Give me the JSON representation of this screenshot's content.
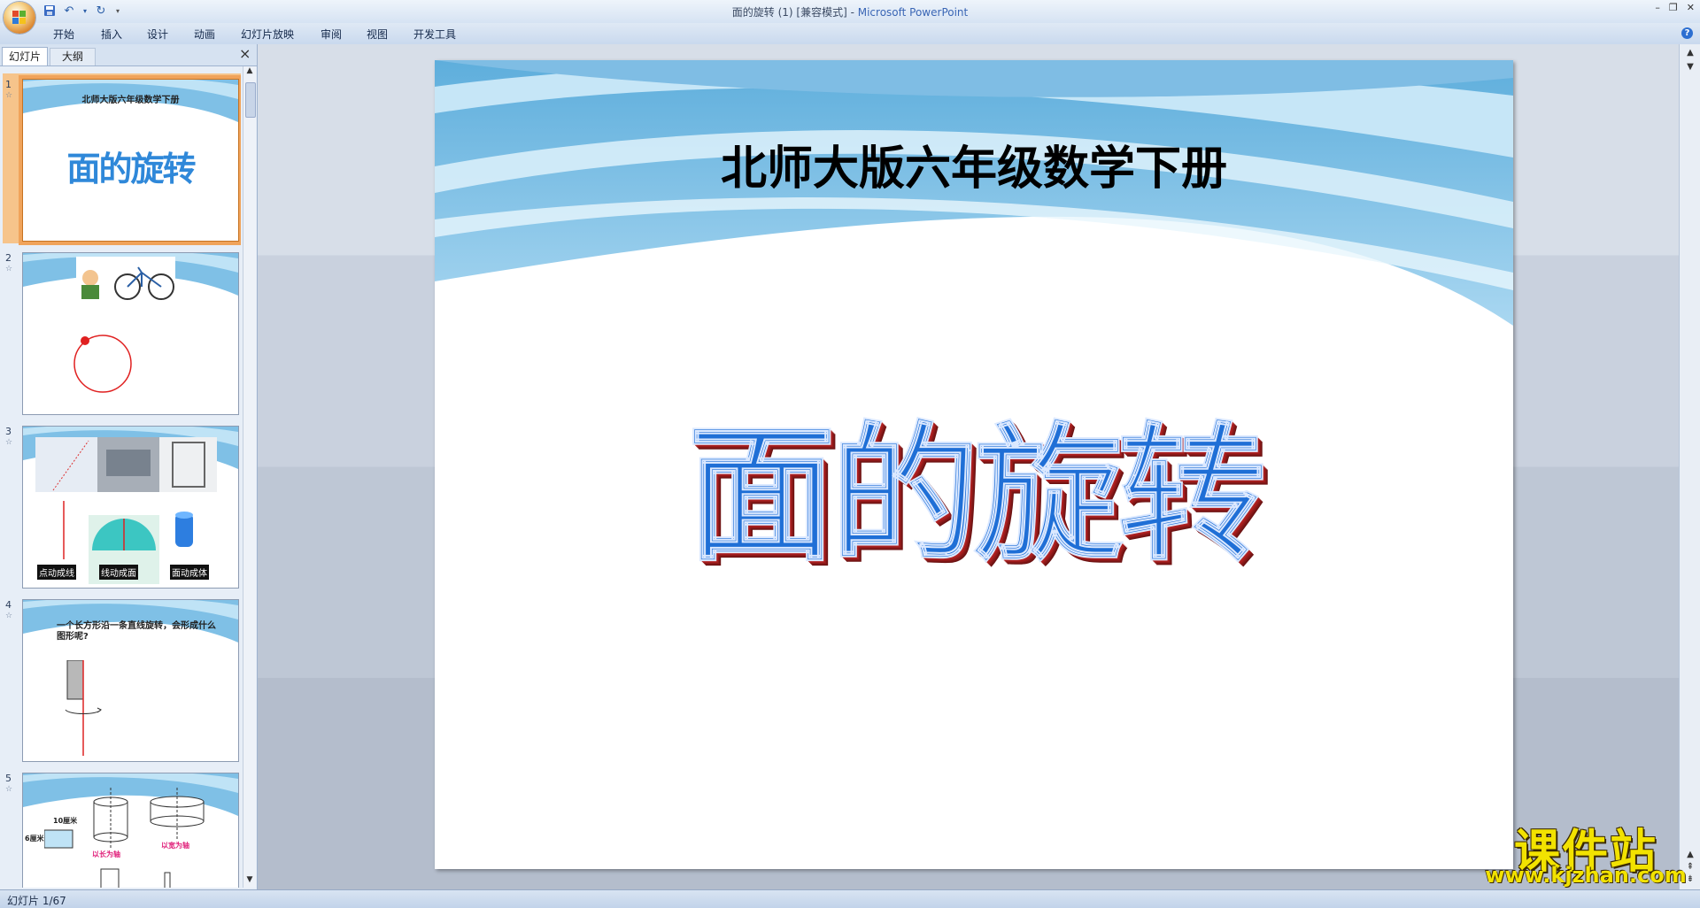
{
  "window": {
    "doc_name": "面的旋转 (1) [兼容模式]",
    "separator": " - ",
    "app_name": "Microsoft PowerPoint"
  },
  "ribbon": {
    "tabs": [
      "开始",
      "插入",
      "设计",
      "动画",
      "幻灯片放映",
      "审阅",
      "视图",
      "开发工具"
    ],
    "help": "?"
  },
  "panel": {
    "tab_slides": "幻灯片",
    "tab_outline": "大纲",
    "close": "×"
  },
  "thumbnails": [
    {
      "num": "1",
      "title": "北师大版六年级数学下册",
      "main": "面的旋转"
    },
    {
      "num": "2"
    },
    {
      "num": "3",
      "labels": [
        "点动成线",
        "线动成面",
        "面动成体"
      ]
    },
    {
      "num": "4",
      "text": "一个长方形沿一条直线旋转，会形成什么图形呢?"
    },
    {
      "num": "5",
      "dim_a": "10厘米",
      "dim_b": "6厘米",
      "cap_a": "以长为轴",
      "cap_b": "以宽为轴"
    }
  ],
  "slide": {
    "subtitle": "北师大版六年级数学下册",
    "title": "面的旋转"
  },
  "status": {
    "slide_counter": "幻灯片 1/67"
  },
  "watermark": {
    "text": "课件站",
    "url": "www.kjzhan.com"
  },
  "colors": {
    "title_blue": "#1f6fd6",
    "title_shadow": "#b22222",
    "selection": "#f0a35a"
  }
}
